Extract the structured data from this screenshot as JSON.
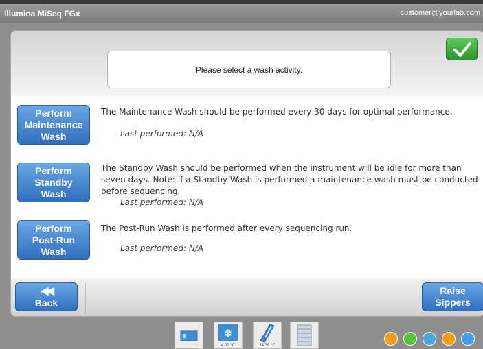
{
  "titlebar": {
    "app_name": "Illumina MiSeq FGx",
    "user": "customer@yourlab.com"
  },
  "message": "Please select a wash activity.",
  "washes": [
    {
      "button": [
        "Perform",
        "Maintenance",
        "Wash"
      ],
      "description": "The Maintenance Wash should be performed every 30 days for optimal performance.",
      "last_performed": "Last performed: N/A"
    },
    {
      "button": [
        "Perform",
        "Standby",
        "Wash"
      ],
      "description": "The Standby Wash should be performed when the instrument will be idle for more than seven days. Note: If a Standby Wash is performed a maintenance wash must be conducted before sequencing.",
      "last_performed": "Last performed: N/A"
    },
    {
      "button": [
        "Perform",
        "Post-Run",
        "Wash"
      ],
      "description": "The Post-Run Wash is performed after every sequencing run.",
      "last_performed": "Last performed: N/A"
    }
  ],
  "footer": {
    "back_arrows": "◀◀",
    "back_label": "Back",
    "raise": [
      "Raise",
      "Sippers"
    ]
  },
  "tray": {
    "chiller_temp": "4.00 °C",
    "flowcell_temp": "24.39 °C"
  },
  "colors": {
    "button_blue": "#3a7bc8",
    "confirm_green": "#2fa234",
    "status": [
      "#f39c12",
      "#58c43a",
      "#45a9dc",
      "#f39c12",
      "#3da0e6"
    ]
  },
  "icons": [
    "checkmark-icon",
    "back-arrows-icon",
    "instrument-icon",
    "chiller-icon",
    "flowcell-icon",
    "reagent-icon",
    "status-icons"
  ]
}
